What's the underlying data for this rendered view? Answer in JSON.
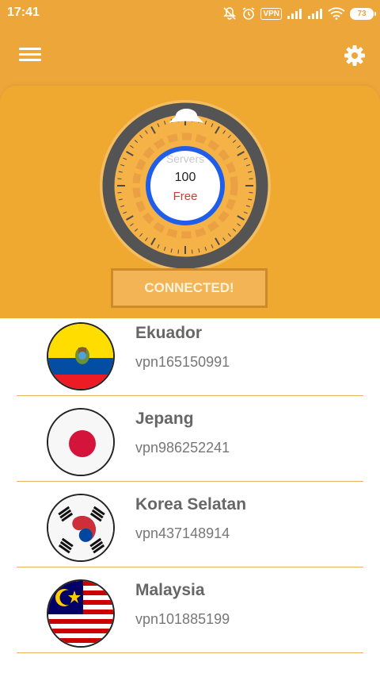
{
  "status_bar": {
    "time": "17:41",
    "icons": [
      "mute-icon",
      "alarm-icon",
      "vpn-badge",
      "signal-icon",
      "signal-icon",
      "wifi-icon",
      "battery-icon"
    ],
    "vpn_label": "VPN",
    "battery_level": "73"
  },
  "header": {
    "menu_icon": "hamburger-icon",
    "settings_icon": "gear-icon"
  },
  "gauge": {
    "label": "Servers",
    "count": "100",
    "plan": "Free"
  },
  "connect_button": {
    "label": "CONNECTED!"
  },
  "servers": [
    {
      "country": "Ekuador",
      "id": "vpn165150991",
      "flag": "ecuador-flag"
    },
    {
      "country": "Jepang",
      "id": "vpn986252241",
      "flag": "japan-flag"
    },
    {
      "country": "Korea Selatan",
      "id": "vpn437148914",
      "flag": "south-korea-flag"
    },
    {
      "country": "Malaysia",
      "id": "vpn101885199",
      "flag": "malaysia-flag"
    }
  ],
  "colors": {
    "primary": "#EDA63A",
    "panel": "#F0A930",
    "free_label": "#D33A2C",
    "gauge_ring": "#1E5EEB",
    "divider": "#EAB063"
  }
}
